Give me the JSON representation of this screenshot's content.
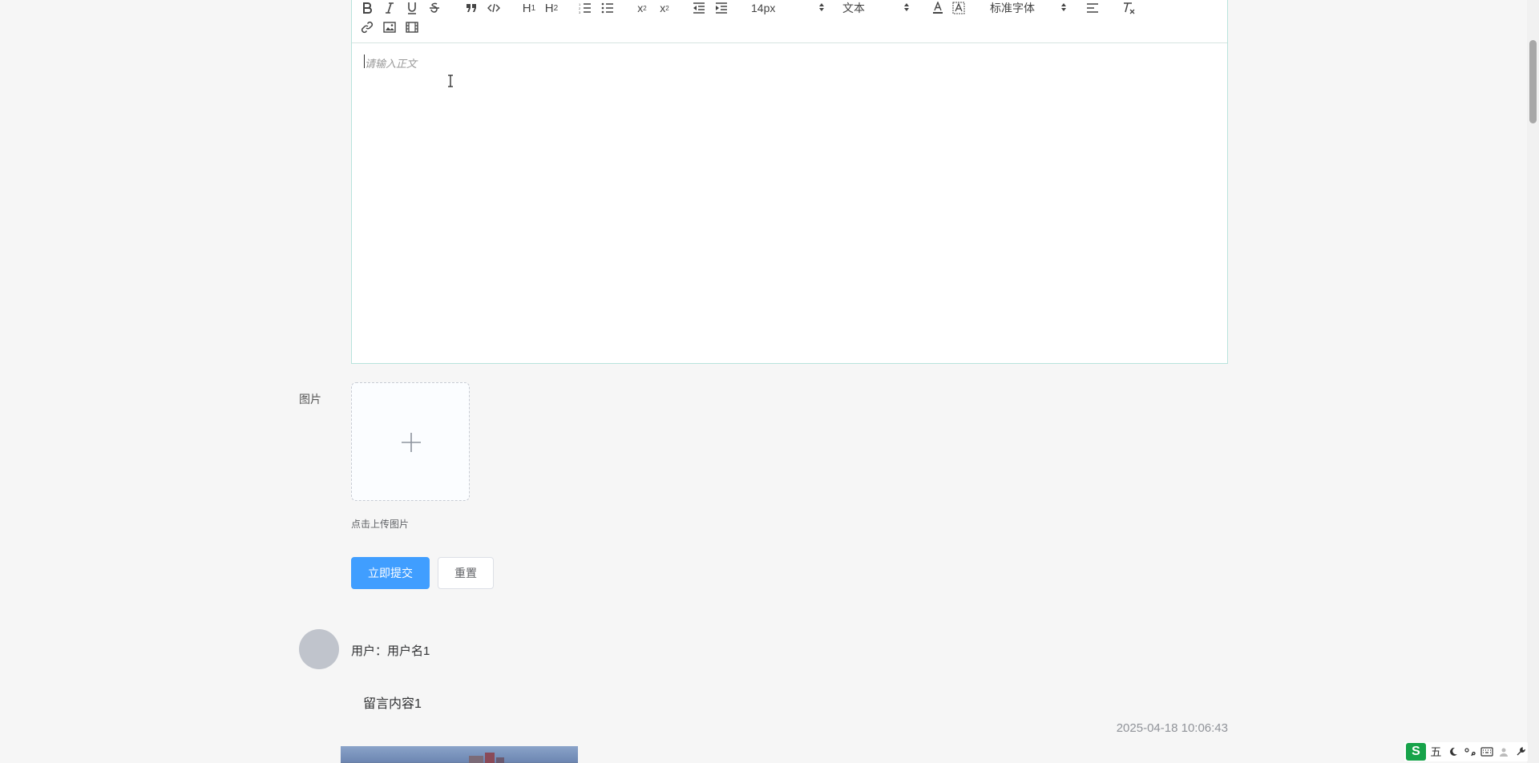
{
  "editor": {
    "font_size": "14px",
    "header_type": "文本",
    "font_family": "标准字体",
    "placeholder": "请输入正文"
  },
  "upload": {
    "label": "图片",
    "tip": "点击上传图片"
  },
  "buttons": {
    "submit": "立即提交",
    "reset": "重置"
  },
  "comment": {
    "user": "用户：用户名1",
    "content": "留言内容1",
    "time": "2025-04-18 10:06:43"
  },
  "ime": {
    "mode": "五"
  },
  "colors": {
    "primary": "#409eff",
    "background": "#f6f6f6",
    "editor_border": "#b8e3dc"
  }
}
